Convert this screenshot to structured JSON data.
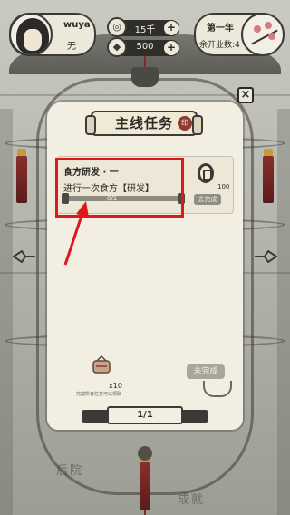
{
  "player": {
    "name": "wuya",
    "title": "无"
  },
  "resources": {
    "coins": "15千",
    "gems": "500"
  },
  "status": {
    "year": "第一年",
    "shops_open": "余开业数:4"
  },
  "panel": {
    "title": "主线任务",
    "pager": "1/1"
  },
  "task": {
    "name": "食方研发 · 一",
    "description": "进行一次食方【研发】",
    "progress_text": "0/1",
    "progress": 0,
    "reward_qty": "100",
    "go_label": "去完成"
  },
  "completion_reward": {
    "qty": "x10",
    "hint": "完成所有任务可以领取",
    "button_label": "未完成"
  },
  "background_labels": {
    "backyard": "后院",
    "achievements": "成就"
  },
  "colors": {
    "highlight": "#e1161d",
    "panel": "#f2eee1",
    "ink": "#2c2a25"
  },
  "icons": {
    "coin": "copper-coin-icon",
    "gem": "jade-icon",
    "close": "close-icon",
    "reward": "scroll-bundle-icon"
  }
}
